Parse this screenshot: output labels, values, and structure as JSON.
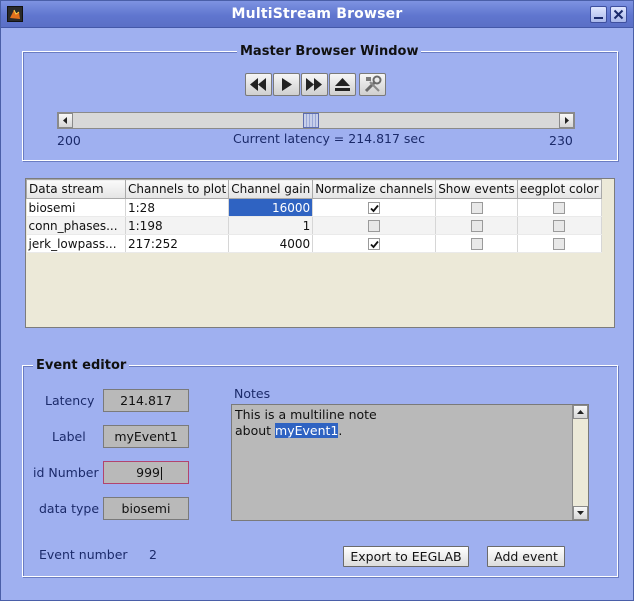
{
  "window": {
    "title": "MultiStream Browser"
  },
  "master": {
    "title": "Master Browser Window",
    "slider_min": "200",
    "slider_max": "230",
    "slider_value_fraction": 0.49,
    "current_latency": "Current latency = 214.817 sec"
  },
  "table": {
    "headers": [
      "Data stream",
      "Channels to plot",
      "Channel gain",
      "Normalize channels",
      "Show events",
      "eegplot color"
    ],
    "rows": [
      {
        "stream": "biosemi",
        "channels": "1:28",
        "gain": "16000",
        "normalize": true,
        "show_events": false,
        "color": false
      },
      {
        "stream": "conn_phases...",
        "channels": "1:198",
        "gain": "1",
        "normalize": false,
        "show_events": false,
        "color": false
      },
      {
        "stream": "jerk_lowpass...",
        "channels": "217:252",
        "gain": "4000",
        "normalize": true,
        "show_events": false,
        "color": false
      }
    ]
  },
  "event_editor": {
    "title": "Event editor",
    "latency_label": "Latency",
    "latency_value": "214.817",
    "label_label": "Label",
    "label_value": "myEvent1",
    "id_label": "id Number",
    "id_value": "999",
    "datatype_label": "data type",
    "datatype_value": "biosemi",
    "notes_label": "Notes",
    "notes_line1": "This is a multiline note",
    "notes_line2_prefix": "about ",
    "notes_line2_highlight": "myEvent1",
    "notes_line2_suffix": ".",
    "event_number_label": "Event number",
    "event_number_value": "2",
    "export_button": "Export to EEGLAB",
    "add_button": "Add event"
  },
  "colors": {
    "window_bg": "#9fb0f0",
    "titlebar": "#6076cf",
    "selection": "#2f63c2"
  }
}
